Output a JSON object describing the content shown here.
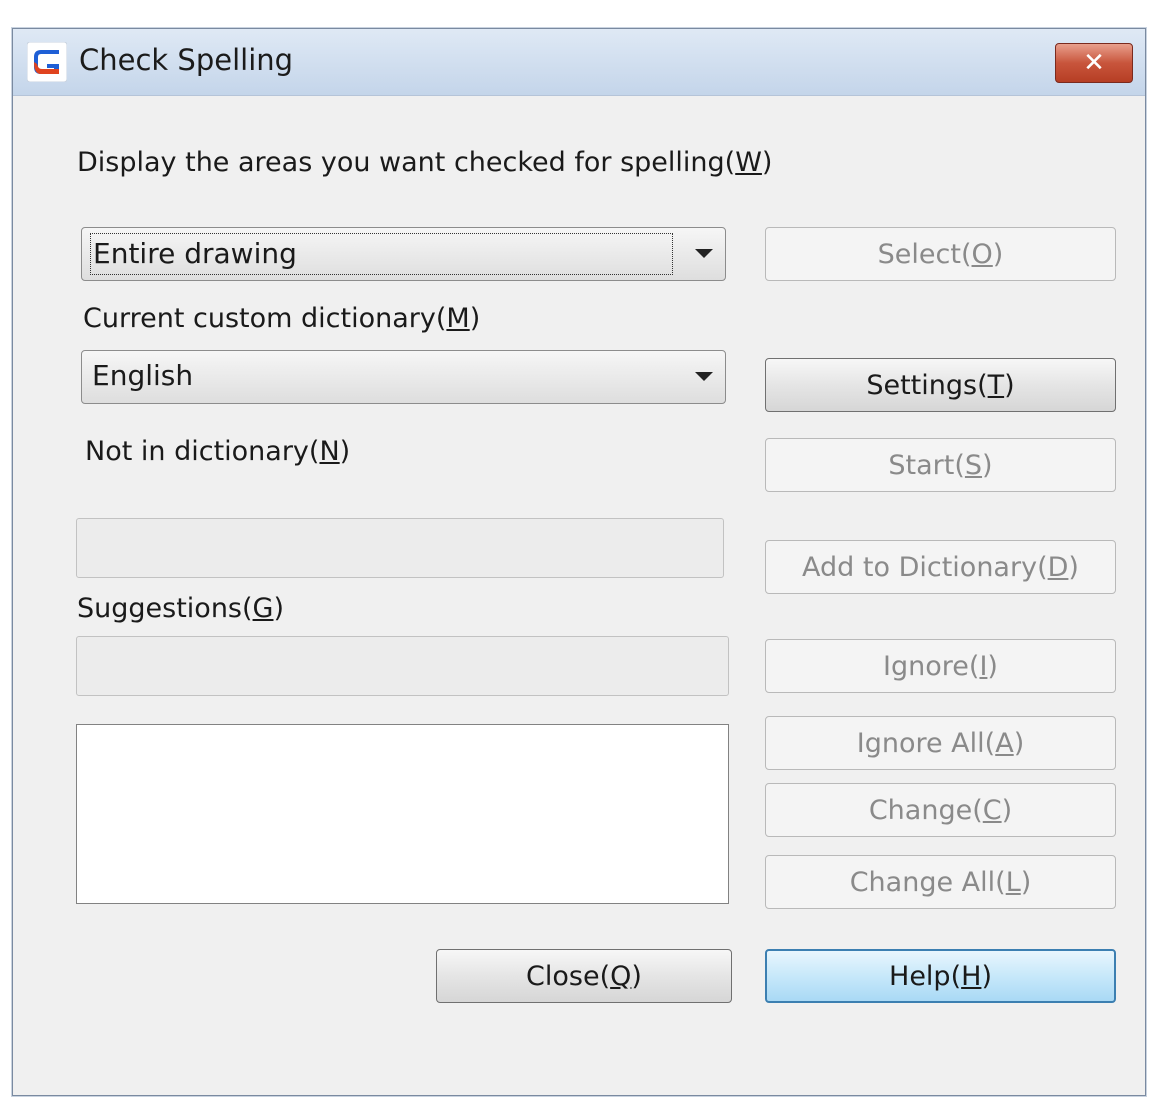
{
  "window": {
    "title": "Check Spelling",
    "close_symbol": "✕",
    "accent": "#c8553c"
  },
  "areas": {
    "label": "Display the areas you want checked for spelling",
    "key": "W",
    "selected": "Entire drawing"
  },
  "dictionary": {
    "label": "Current custom dictionary",
    "key": "M",
    "selected": "English"
  },
  "not_in_dictionary": {
    "label": "Not in dictionary",
    "key": "N",
    "value": ""
  },
  "suggestions": {
    "label": "Suggestions",
    "key": "G",
    "value": "",
    "items": []
  },
  "buttons": {
    "select": {
      "label": "Select",
      "key": "O"
    },
    "settings": {
      "label": "Settings",
      "key": "T"
    },
    "start": {
      "label": "Start",
      "key": "S"
    },
    "add_to_dictionary": {
      "label": "Add to Dictionary",
      "key": "D"
    },
    "ignore": {
      "label": "Ignore",
      "key": "I"
    },
    "ignore_all": {
      "label": "Ignore All",
      "key": "A"
    },
    "change": {
      "label": "Change",
      "key": "C"
    },
    "change_all": {
      "label": "Change All",
      "key": "L"
    },
    "close": {
      "label": "Close",
      "key": "Q"
    },
    "help": {
      "label": "Help",
      "key": "H"
    }
  }
}
